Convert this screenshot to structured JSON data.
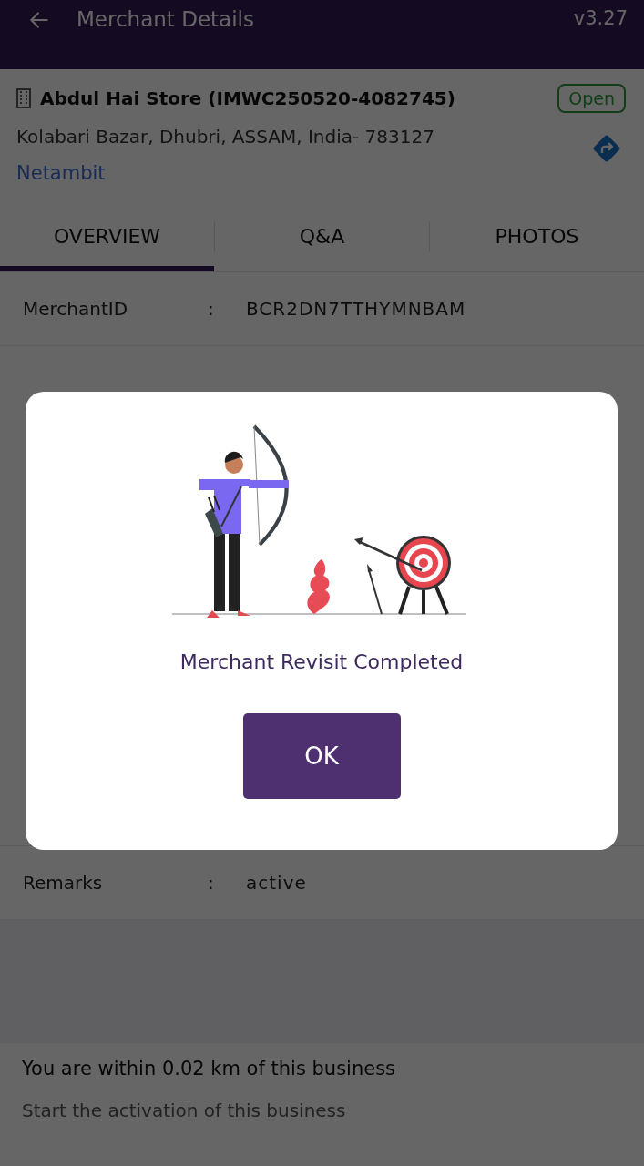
{
  "header": {
    "title": "Merchant Details",
    "version": "v3.27"
  },
  "merchant": {
    "name": "Abdul Hai Store (IMWC250520-4082745)",
    "status": "Open",
    "address": "Kolabari Bazar, Dhubri, ASSAM, India- 783127",
    "link": "Netambit"
  },
  "tabs": [
    {
      "label": "OVERVIEW",
      "selected": true
    },
    {
      "label": "Q&A",
      "selected": false
    },
    {
      "label": "PHOTOS",
      "selected": false
    }
  ],
  "details": [
    {
      "label": "MerchantID",
      "separator": ":",
      "value": "BCR2DN7TTHYMNBAM"
    },
    {
      "label": "Remarks",
      "separator": ":",
      "value": "active"
    }
  ],
  "footer": {
    "distance": "You are within 0.02 km of this business",
    "hint": "Start the activation of this business"
  },
  "dialog": {
    "message": "Merchant Revisit Completed",
    "button": "OK"
  }
}
